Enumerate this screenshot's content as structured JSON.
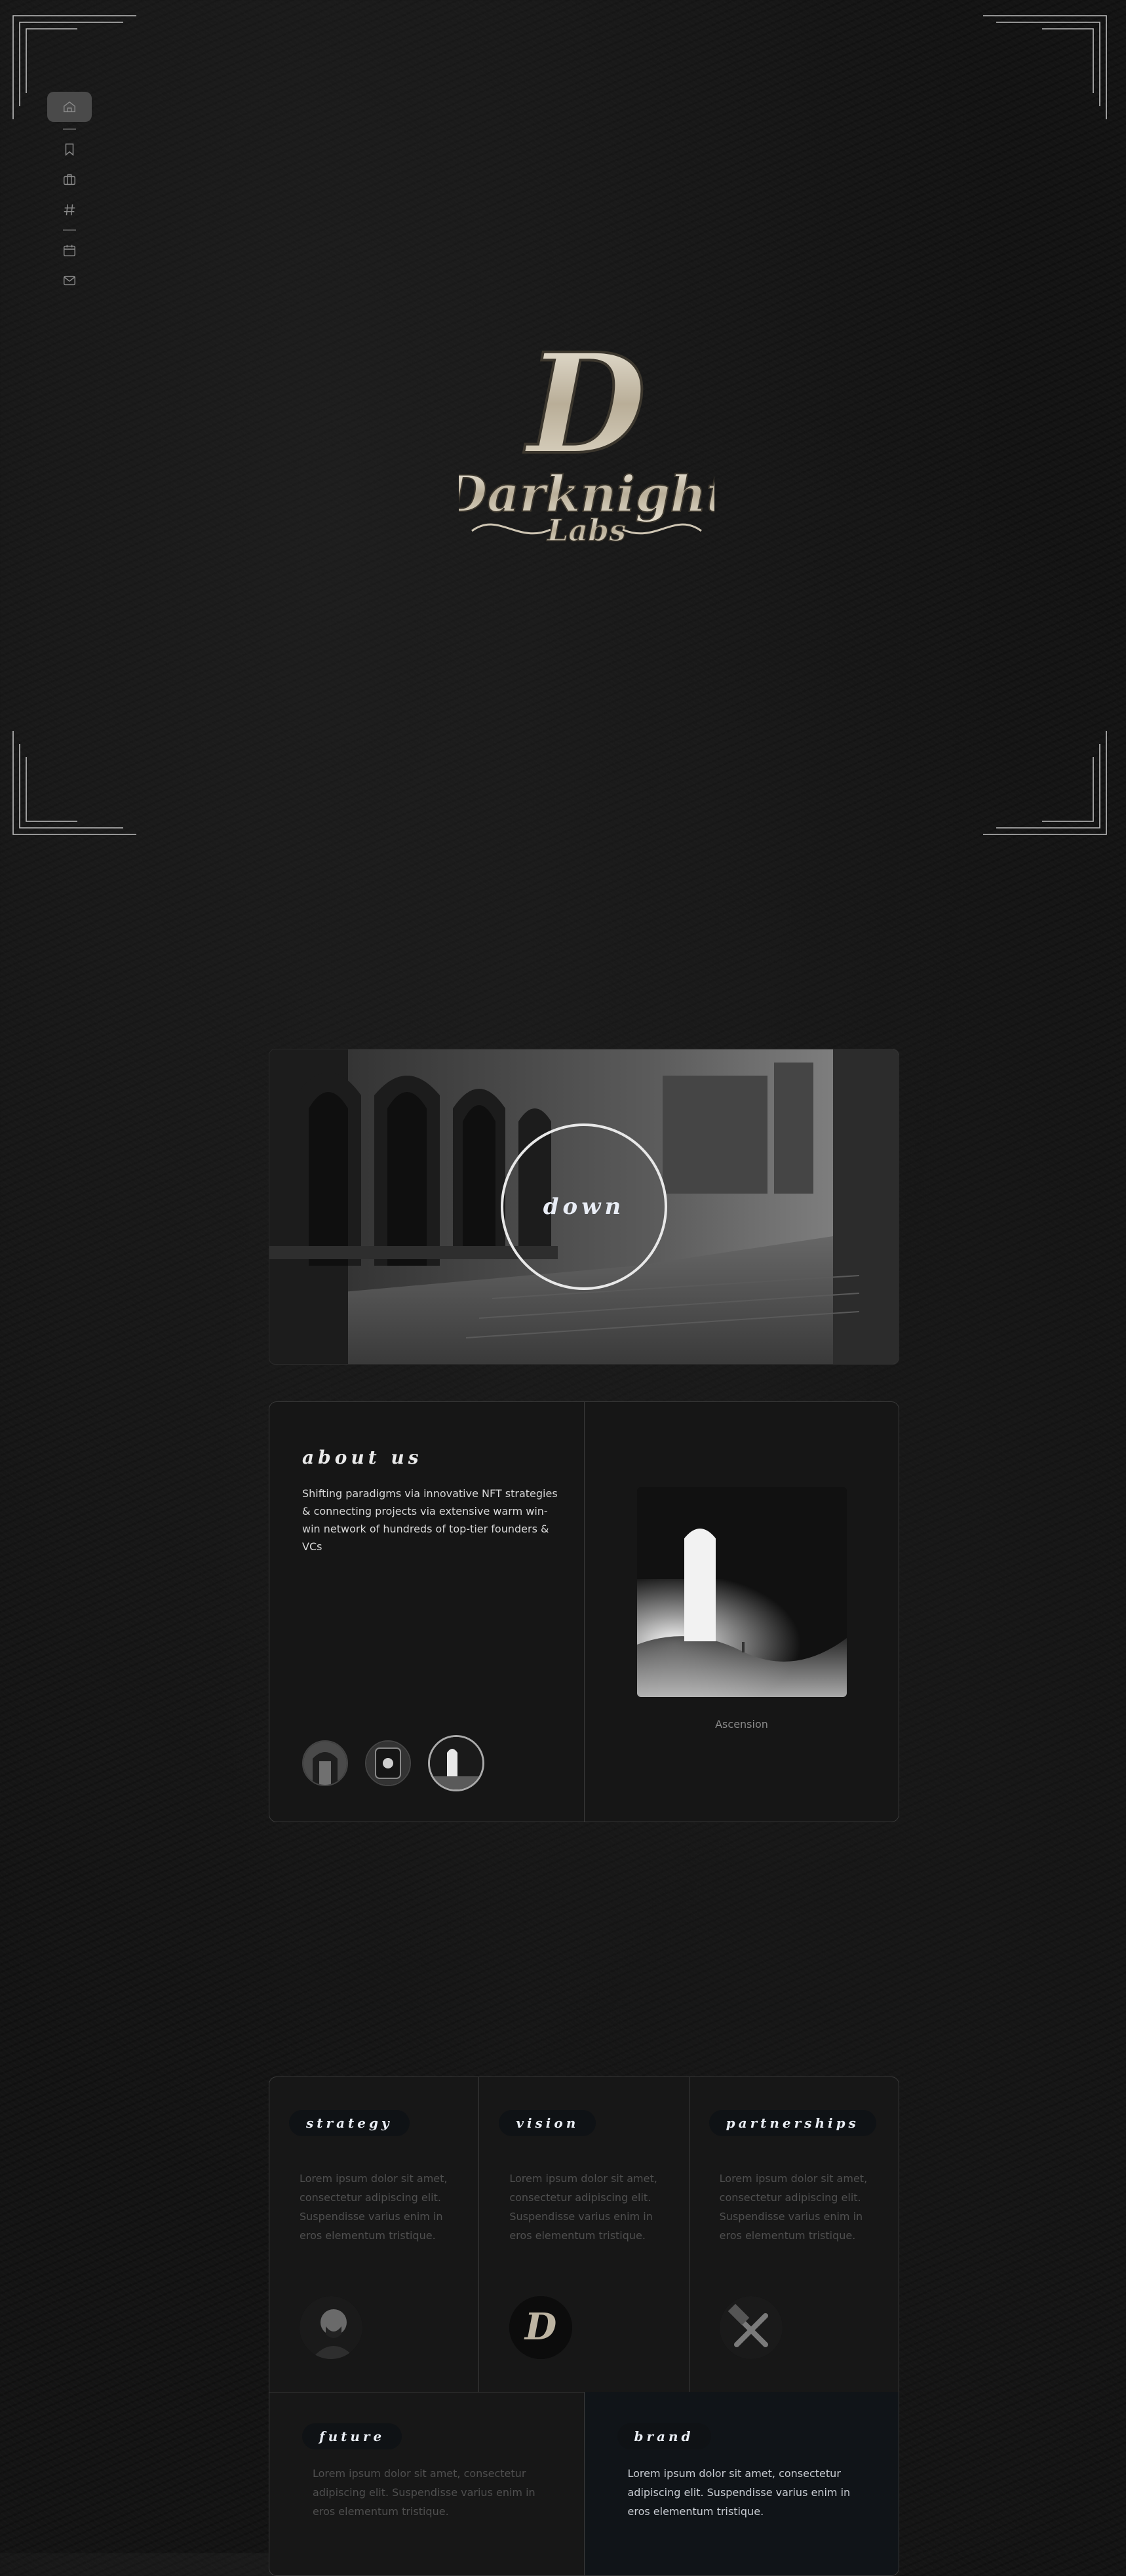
{
  "sidebar": {
    "items": [
      {
        "icon": "home-icon",
        "active": true
      },
      {
        "icon": "bookmark-icon"
      },
      {
        "icon": "briefcase-icon"
      },
      {
        "icon": "hash-icon"
      },
      {
        "icon": "calendar-icon"
      },
      {
        "icon": "mail-icon"
      }
    ]
  },
  "logo": {
    "monogram": "D",
    "line1": "Darknight",
    "line2": "Labs"
  },
  "hero": {
    "button_label": "down"
  },
  "about": {
    "title": "about us",
    "text": "Shifting paradigms via innovative NFT strategies & connecting projects via extensive warm win-win network of hundreds of top-tier founders & VCs",
    "caption": "Ascension"
  },
  "services": {
    "strategy": {
      "label": "strategy",
      "text": "Lorem ipsum dolor sit amet, consectetur adipiscing elit. Suspendisse varius enim in eros elementum tristique."
    },
    "vision": {
      "label": "vision",
      "text": "Lorem ipsum dolor sit amet, consectetur adipiscing elit. Suspendisse varius enim in eros elementum tristique."
    },
    "partnerships": {
      "label": "partnerships",
      "text": "Lorem ipsum dolor sit amet, consectetur adipiscing elit. Suspendisse varius enim in eros elementum tristique."
    },
    "future": {
      "label": "future",
      "text": "Lorem ipsum dolor sit amet, consectetur adipiscing elit. Suspendisse varius enim in eros elementum tristique."
    },
    "brand": {
      "label": "brand",
      "text": "Lorem ipsum dolor sit amet, consectetur adipiscing elit. Suspendisse varius enim in eros elementum tristique."
    }
  },
  "colors": {
    "background": "#141414",
    "card": "#161616",
    "border": "#3a3a3a",
    "logo_metal": "#cfc6b4",
    "brand_panel": "#101418"
  }
}
